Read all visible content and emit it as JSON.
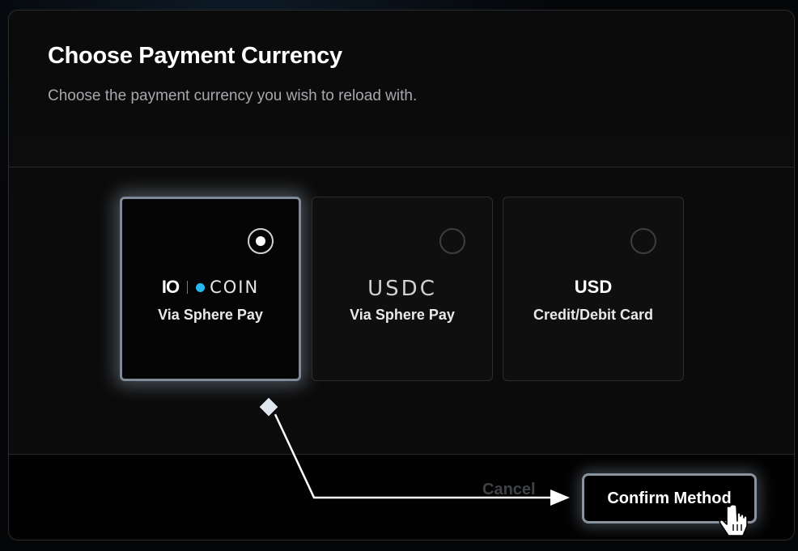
{
  "dialog": {
    "title": "Choose Payment Currency",
    "subtitle": "Choose the payment currency you wish to reload with."
  },
  "options": [
    {
      "brand_io": "IO",
      "brand_coin": "COIN",
      "subtitle": "Via Sphere Pay",
      "selected": true
    },
    {
      "brand": "USDC",
      "subtitle": "Via Sphere Pay",
      "selected": false
    },
    {
      "brand": "USD",
      "subtitle": "Credit/Debit Card",
      "selected": false
    }
  ],
  "footer": {
    "cancel_label": "Cancel",
    "confirm_label": "Confirm Method"
  },
  "colors": {
    "accent_blue": "#27b8f0",
    "highlight_border": "#8a93a0"
  },
  "icons": {
    "pointer": "hand-pointer-icon",
    "arrow": "arrow-right-icon"
  }
}
